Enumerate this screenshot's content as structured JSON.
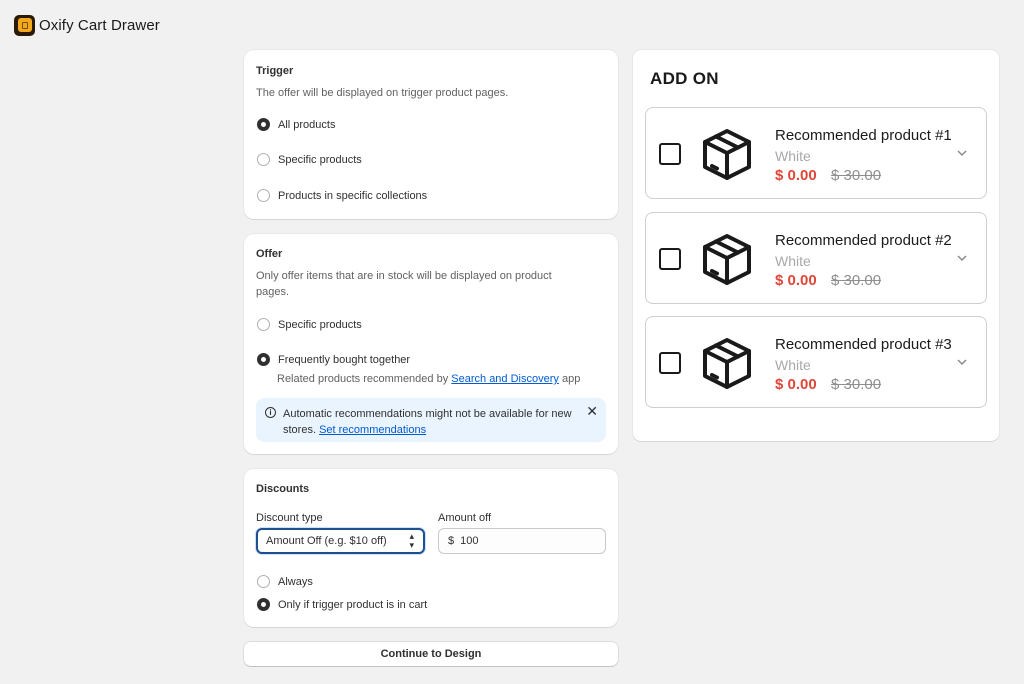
{
  "app": {
    "title": "Oxify Cart Drawer"
  },
  "trigger": {
    "title": "Trigger",
    "description": "The offer will be displayed on trigger product pages.",
    "options": [
      {
        "label": "All products",
        "selected": true
      },
      {
        "label": "Specific products",
        "selected": false
      },
      {
        "label": "Products in specific collections",
        "selected": false
      }
    ]
  },
  "offer": {
    "title": "Offer",
    "description": "Only offer items that are in stock will be displayed on product pages.",
    "options": [
      {
        "label": "Specific products",
        "selected": false
      },
      {
        "label": "Frequently bought together",
        "selected": true
      }
    ],
    "related_prefix": "Related products recommended by",
    "related_link": "Search and Discovery",
    "related_suffix": "app",
    "banner_text": "Automatic recommendations might not be available for new stores.",
    "banner_link": "Set recommendations"
  },
  "discounts": {
    "title": "Discounts",
    "type_label": "Discount type",
    "type_value": "Amount Off (e.g. $10 off)",
    "amount_label": "Amount off",
    "amount_prefix": "$",
    "amount_value": "100",
    "options": [
      {
        "label": "Always",
        "selected": false
      },
      {
        "label": "Only if trigger product is in cart",
        "selected": true
      }
    ]
  },
  "continue_label": "Continue to Design",
  "preview": {
    "title": "ADD ON",
    "products": [
      {
        "name": "Recommended product #1",
        "variant": "White",
        "price": "$ 0.00",
        "compare_price": "$ 30.00"
      },
      {
        "name": "Recommended product #2",
        "variant": "White",
        "price": "$ 0.00",
        "compare_price": "$ 30.00"
      },
      {
        "name": "Recommended product #3",
        "variant": "White",
        "price": "$ 0.00",
        "compare_price": "$ 30.00"
      }
    ]
  },
  "colors": {
    "accent_link": "#005bd3",
    "price_red": "#e0463a",
    "banner_bg": "#eaf4ff",
    "focus_border": "#1d4f91"
  }
}
